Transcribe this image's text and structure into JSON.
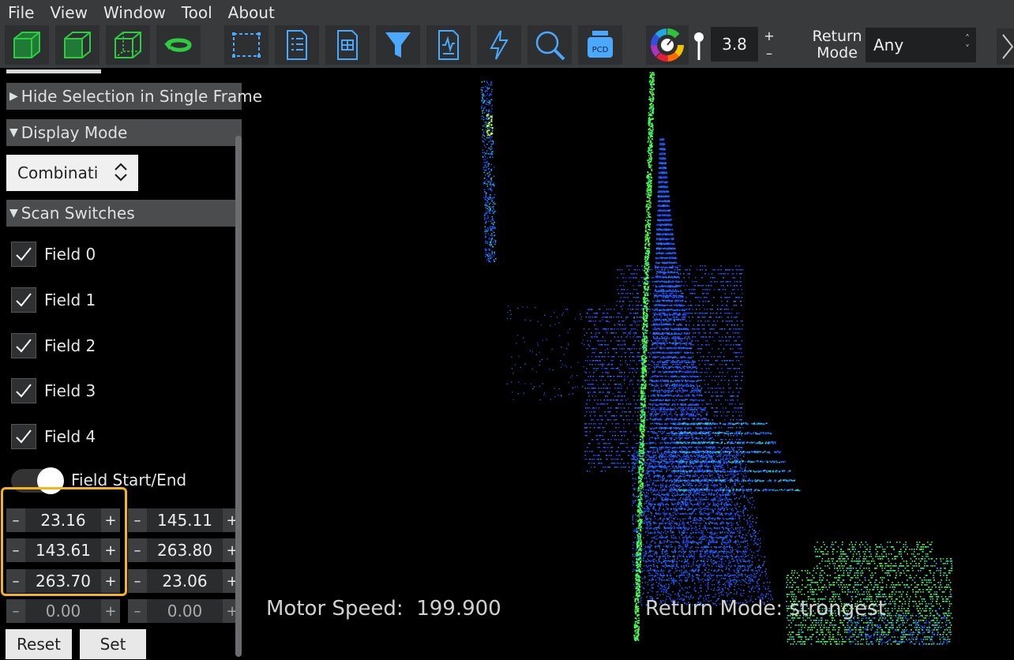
{
  "menu": [
    "File",
    "View",
    "Window",
    "Tool",
    "About"
  ],
  "toolbar": {
    "icons": [
      "cube-solid-icon",
      "cube-front-icon",
      "cube-wire-icon",
      "rotate-icon",
      "select-region-icon",
      "list-doc-icon",
      "grid-doc-icon",
      "filter-icon",
      "chart-doc-icon",
      "lightning-icon",
      "zoom-icon",
      "pcd-icon",
      "color-wheel-icon",
      "point-size-icon"
    ],
    "pcd_label": "PCD",
    "point_size": "3.8",
    "plus": "+",
    "minus": "–",
    "return_mode_label_1": "Return",
    "return_mode_label_2": "Mode",
    "return_mode_value": "Any"
  },
  "panel": {
    "hide_selection": "Hide Selection in Single Frame",
    "display_mode_header": "Display Mode",
    "display_mode_value": "Combinati",
    "scan_switches_header": "Scan Switches",
    "fields": [
      "Field 0",
      "Field 1",
      "Field 2",
      "Field 3",
      "Field 4"
    ],
    "field_start_end": "Field Start/End",
    "ranges": [
      {
        "start": "23.16",
        "end": "145.11"
      },
      {
        "start": "143.61",
        "end": "263.80"
      },
      {
        "start": "263.70",
        "end": "23.06"
      },
      {
        "start": "0.00",
        "end": "0.00"
      }
    ],
    "minus": "–",
    "plus": "+",
    "reset": "Reset",
    "set": "Set"
  },
  "view": {
    "motor_speed_label": "Motor Speed:",
    "motor_speed_value": "199.900",
    "return_mode_text": "Return Mode: strongest"
  },
  "colors": {
    "accent_highlight": "#f5b418",
    "icon_blue": "#4aa8ff",
    "icon_green": "#2ecc40"
  }
}
